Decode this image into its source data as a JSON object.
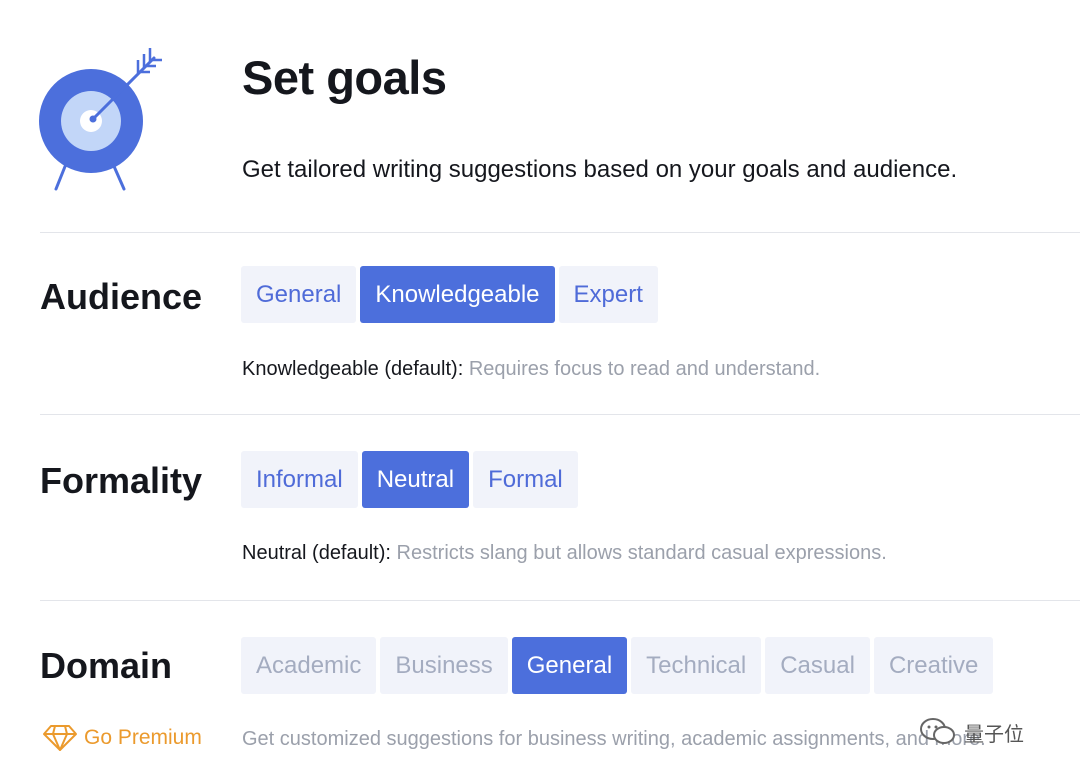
{
  "header": {
    "title": "Set goals",
    "subtitle": "Get tailored writing suggestions based on your goals and audience."
  },
  "audience": {
    "label": "Audience",
    "options": [
      "General",
      "Knowledgeable",
      "Expert"
    ],
    "selected": "Knowledgeable",
    "description_key": "Knowledgeable (default):",
    "description_value": "Requires focus to read and understand."
  },
  "formality": {
    "label": "Formality",
    "options": [
      "Informal",
      "Neutral",
      "Formal"
    ],
    "selected": "Neutral",
    "description_key": "Neutral (default):",
    "description_value": "Restricts slang but allows standard casual expressions."
  },
  "domain": {
    "label": "Domain",
    "options": [
      "Academic",
      "Business",
      "General",
      "Technical",
      "Casual",
      "Creative"
    ],
    "selected": "General",
    "description": "Get customized suggestions for business writing, academic assignments, and more."
  },
  "premium": {
    "label": "Go Premium",
    "icon": "diamond-icon"
  },
  "watermark": {
    "text": "量子位",
    "icon": "wechat-icon"
  },
  "colors": {
    "accent": "#4c6fdc",
    "option_text": "#4f6bd8",
    "option_bg": "#f1f3fa",
    "premium": "#eb9a2d",
    "muted_text": "#9ba0ab"
  }
}
